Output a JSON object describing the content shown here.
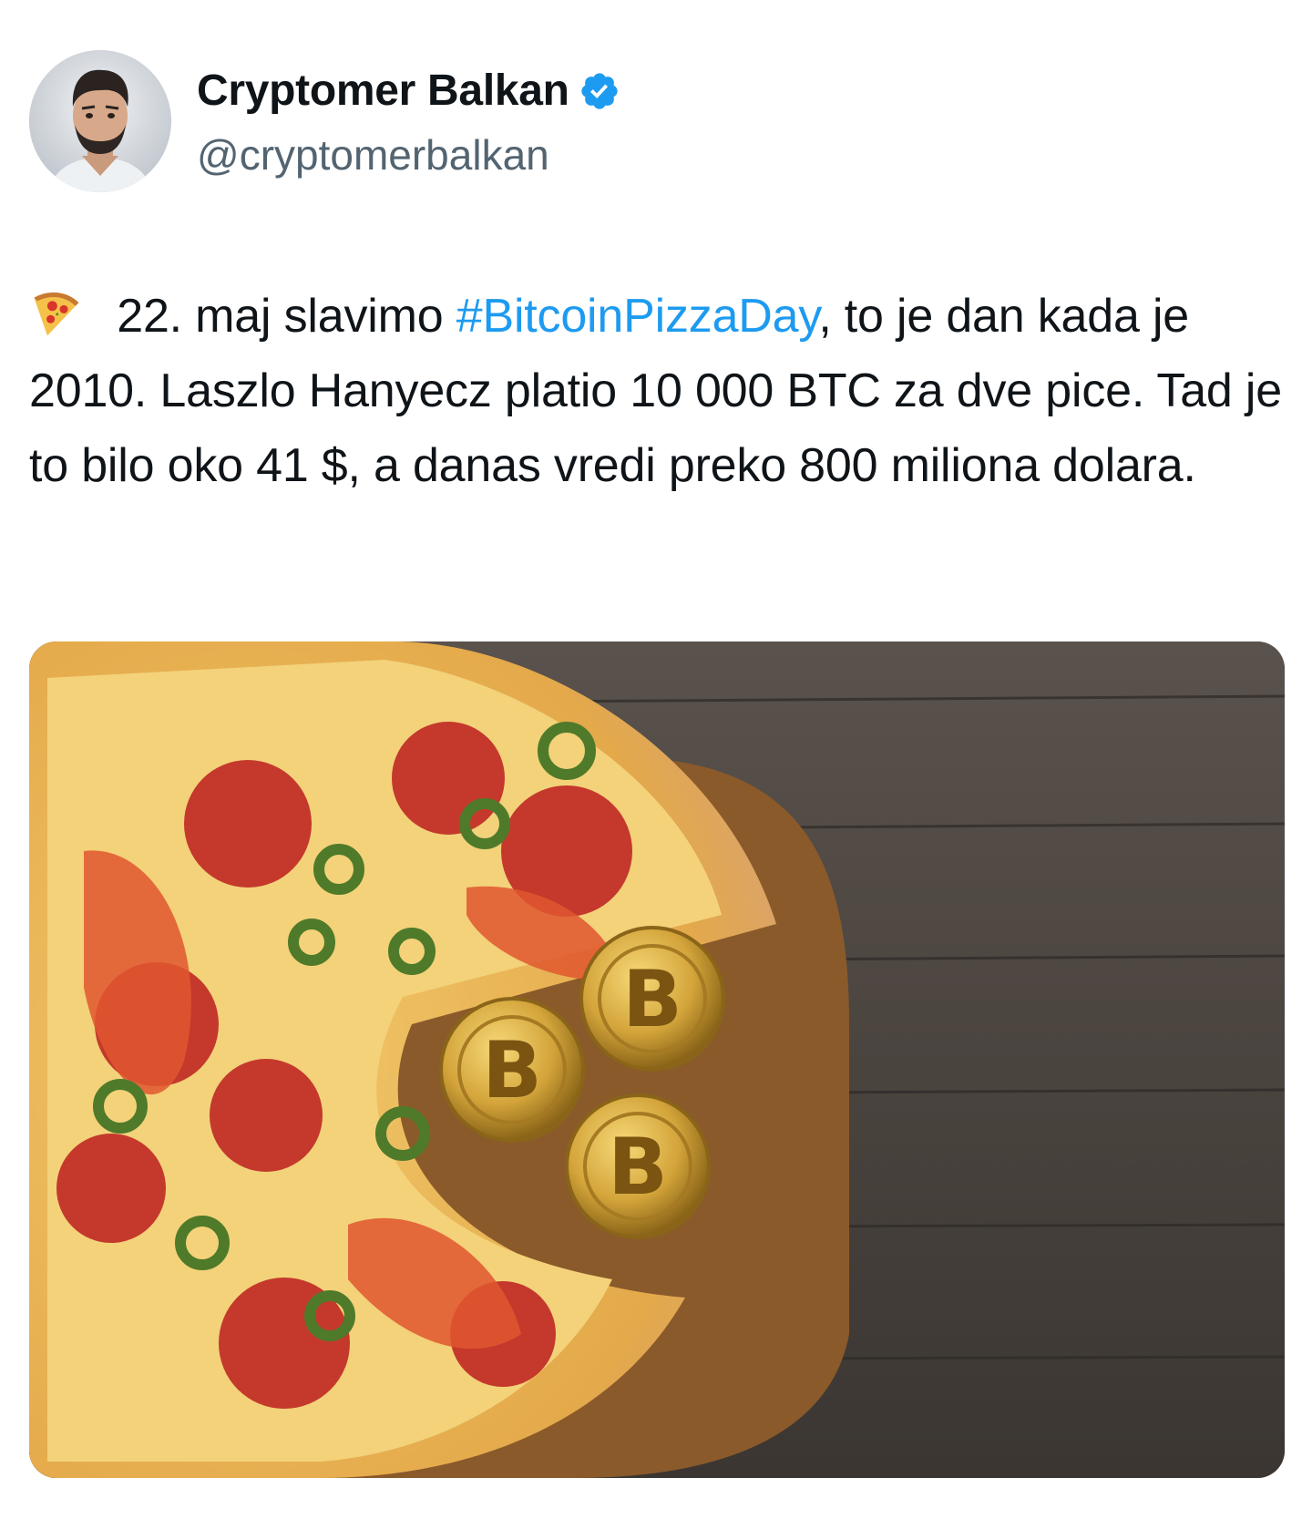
{
  "author": {
    "display_name": "Cryptomer Balkan",
    "handle": "@cryptomerbalkan",
    "verified": true,
    "avatar_icon": "user-avatar",
    "verified_icon": "verified-badge-icon",
    "verified_color": "#1d9bf0"
  },
  "tweet": {
    "emoji": "pizza-emoji",
    "text_before": " 22. maj slavimo ",
    "hashtag": "#BitcoinPizzaDay",
    "text_after": ", to je dan kada je 2010. Laszlo Hanyecz platio 10 000 BTC za dve pice. Tad je to bilo oko 41 $, a danas vredi preko 800 miliona dolara.",
    "hashtag_color": "#1d9bf0"
  },
  "media": {
    "image_icon": "pizza-and-bitcoin-photo",
    "coin_symbol": "B"
  }
}
